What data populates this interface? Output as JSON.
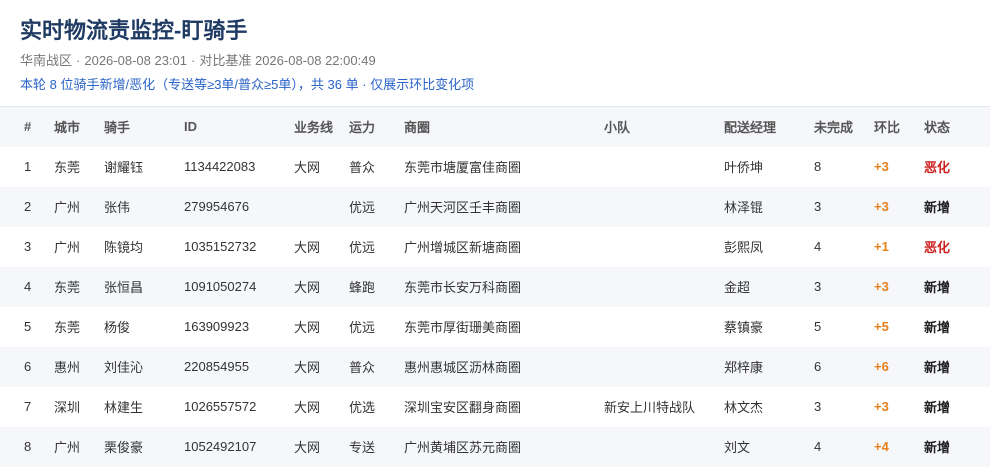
{
  "header": {
    "title": "实时物流责监控-盯骑手",
    "region": "华南战区",
    "time": "2026-08-08 23:01",
    "baseline": "对比基准 2026-08-08 22:00:49",
    "note": "本轮 8 位骑手新增/恶化（专送等≥3单/普众≥5单），共 36 单 · 仅展示环比变化项"
  },
  "columns": [
    "#",
    "城市",
    "骑手",
    "ID",
    "业务线",
    "运力",
    "商圈",
    "小队",
    "配送经理",
    "未完成",
    "环比",
    "状态"
  ],
  "rows": [
    {
      "idx": "1",
      "city": "东莞",
      "rider": "谢耀钰",
      "id": "1134422083",
      "biz": "大网",
      "capacity": "普众",
      "zone": "东莞市塘厦富佳商圈",
      "team": "",
      "manager": "叶侨坤",
      "pending": "8",
      "delta": "+3",
      "status": "恶化",
      "status_type": "bad"
    },
    {
      "idx": "2",
      "city": "广州",
      "rider": "张伟",
      "id": "279954676",
      "biz": "",
      "capacity": "优远",
      "zone": "广州天河区壬丰商圈",
      "team": "",
      "manager": "林泽锟",
      "pending": "3",
      "delta": "+3",
      "status": "新增",
      "status_type": "new"
    },
    {
      "idx": "3",
      "city": "广州",
      "rider": "陈镜均",
      "id": "1035152732",
      "biz": "大网",
      "capacity": "优远",
      "zone": "广州增城区新塘商圈",
      "team": "",
      "manager": "彭熙凤",
      "pending": "4",
      "delta": "+1",
      "status": "恶化",
      "status_type": "bad"
    },
    {
      "idx": "4",
      "city": "东莞",
      "rider": "张恒昌",
      "id": "1091050274",
      "biz": "大网",
      "capacity": "蜂跑",
      "zone": "东莞市长安万科商圈",
      "team": "",
      "manager": "金超",
      "pending": "3",
      "delta": "+3",
      "status": "新增",
      "status_type": "new"
    },
    {
      "idx": "5",
      "city": "东莞",
      "rider": "杨俊",
      "id": "163909923",
      "biz": "大网",
      "capacity": "优远",
      "zone": "东莞市厚街珊美商圈",
      "team": "",
      "manager": "蔡镇豪",
      "pending": "5",
      "delta": "+5",
      "status": "新增",
      "status_type": "new"
    },
    {
      "idx": "6",
      "city": "惠州",
      "rider": "刘佳沁",
      "id": "220854955",
      "biz": "大网",
      "capacity": "普众",
      "zone": "惠州惠城区沥林商圈",
      "team": "",
      "manager": "郑梓康",
      "pending": "6",
      "delta": "+6",
      "status": "新增",
      "status_type": "new"
    },
    {
      "idx": "7",
      "city": "深圳",
      "rider": "林建生",
      "id": "1026557572",
      "biz": "大网",
      "capacity": "优选",
      "zone": "深圳宝安区翻身商圈",
      "team": "新安上川特战队",
      "manager": "林文杰",
      "pending": "3",
      "delta": "+3",
      "status": "新增",
      "status_type": "new"
    },
    {
      "idx": "8",
      "city": "广州",
      "rider": "栗俊豪",
      "id": "1052492107",
      "biz": "大网",
      "capacity": "专送",
      "zone": "广州黄埔区苏元商圈",
      "team": "",
      "manager": "刘文",
      "pending": "4",
      "delta": "+4",
      "status": "新增",
      "status_type": "new"
    }
  ]
}
